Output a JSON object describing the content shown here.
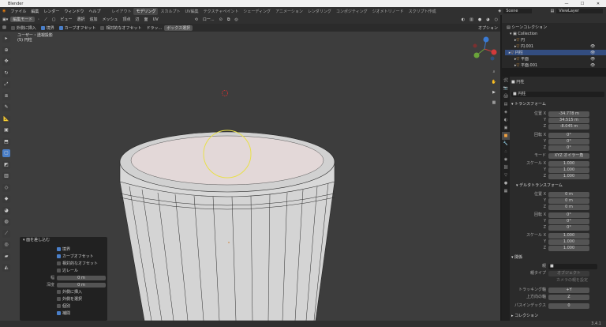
{
  "window": {
    "title": "Blender",
    "min": "—",
    "max": "☐",
    "close": "✕"
  },
  "menu": [
    "ファイル",
    "編集",
    "レンダー",
    "ウィンドウ",
    "ヘルプ"
  ],
  "workspaces": [
    "レイアウト",
    "モデリング",
    "スカルプト",
    "UV編集",
    "テクスチャペイント",
    "シェーディング",
    "アニメーション",
    "レンダリング",
    "コンポジティング",
    "ジオメトリノード",
    "スクリプト作成"
  ],
  "active_workspace": "モデリング",
  "scene": {
    "label": "Scene",
    "viewlayer": "ViewLayer"
  },
  "header": {
    "mode": "編集モード",
    "items": [
      "ビュー",
      "選択",
      "追加",
      "メッシュ",
      "頂点",
      "辺",
      "面",
      "UV"
    ],
    "transform": "ロー..."
  },
  "tool_header": {
    "items": [
      {
        "label": "外側に挿入",
        "on": false
      },
      {
        "label": "境界",
        "on": true
      },
      {
        "label": "カーブオフセット",
        "on": true
      },
      {
        "label": "相対的なオフセット",
        "on": false
      }
    ],
    "drag": "ドラッ...",
    "box": "ボックス選択",
    "options": "オプション"
  },
  "viewport_info": {
    "line1": "ユーザー・透視投影",
    "line2": "(5) 円柱"
  },
  "op_panel": {
    "title": "面を差し込む",
    "rows": [
      {
        "type": "check",
        "label": "境界",
        "on": true
      },
      {
        "type": "check",
        "label": "カーブオフセット",
        "on": true
      },
      {
        "type": "check",
        "label": "相対的なオフセット",
        "on": false
      },
      {
        "type": "check",
        "label": "辺レール",
        "on": false
      },
      {
        "type": "field",
        "label": "幅",
        "value": "0 m"
      },
      {
        "type": "field",
        "label": "深度",
        "value": "0 m"
      },
      {
        "type": "check",
        "label": "外側に挿入",
        "on": false
      },
      {
        "type": "check",
        "label": "外側を選択",
        "on": false
      },
      {
        "type": "check",
        "label": "個別",
        "on": false
      },
      {
        "type": "check",
        "label": "補間",
        "on": true
      }
    ]
  },
  "outliner": {
    "header": "シーンコレクション",
    "collection": "Collection",
    "items": [
      "円",
      "円.001",
      "円柱",
      "平面",
      "平面.001"
    ],
    "selected": "円柱"
  },
  "properties": {
    "object_name": "円柱",
    "object_field": "円柱",
    "transform_title": "トランスフォーム",
    "location": [
      {
        "l": "位置 X",
        "v": "-34.778 m"
      },
      {
        "l": "Y",
        "v": "34.515 m"
      },
      {
        "l": "Z",
        "v": "-8.045 m"
      }
    ],
    "rotation": [
      {
        "l": "回転 X",
        "v": "0°"
      },
      {
        "l": "Y",
        "v": "0°"
      },
      {
        "l": "Z",
        "v": "0°"
      }
    ],
    "mode_label": "モード",
    "mode_value": "XYZ オイラー角",
    "scale": [
      {
        "l": "スケール X",
        "v": "1.000"
      },
      {
        "l": "Y",
        "v": "1.000"
      },
      {
        "l": "Z",
        "v": "1.000"
      }
    ],
    "delta_title": "デルタトランスフォーム",
    "d_location": [
      {
        "l": "位置 X",
        "v": "0 m"
      },
      {
        "l": "Y",
        "v": "0 m"
      },
      {
        "l": "Z",
        "v": "0 m"
      }
    ],
    "d_rotation": [
      {
        "l": "回転 X",
        "v": "0°"
      },
      {
        "l": "Y",
        "v": "0°"
      },
      {
        "l": "Z",
        "v": "0°"
      }
    ],
    "d_scale": [
      {
        "l": "スケール X",
        "v": "1.000"
      },
      {
        "l": "Y",
        "v": "1.000"
      },
      {
        "l": "Z",
        "v": "1.000"
      }
    ],
    "relations_title": "関係",
    "parent_label": "親",
    "parent_type_label": "親タイプ",
    "parent_type_value": "オブジェクト",
    "parent_note": "カメラの親を設定",
    "track_label": "トラッキング軸",
    "track_value": "+Y",
    "up_label": "上方向の軸",
    "up_value": "Z",
    "pass_label": "パスインデックス",
    "pass_value": "0",
    "collection_title": "コレクション"
  },
  "status": {
    "version": "3.4.1"
  }
}
